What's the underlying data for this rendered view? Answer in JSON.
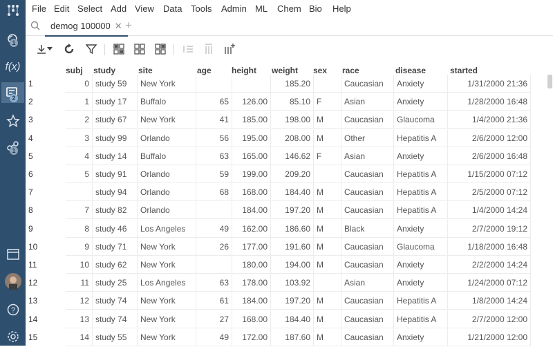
{
  "menu": [
    "File",
    "Edit",
    "Select",
    "Add",
    "View",
    "Data",
    "Tools",
    "Admin",
    "ML",
    "Chem",
    "Bio",
    "Help"
  ],
  "tab": {
    "label": "demog 100000"
  },
  "sidebar_badges": {
    "browse": "1",
    "tables": "2",
    "network": "1"
  },
  "columns": [
    "subj",
    "study",
    "site",
    "age",
    "height",
    "weight",
    "sex",
    "race",
    "disease",
    "started"
  ],
  "rows": [
    {
      "n": "1",
      "subj": "0",
      "study": "study 59",
      "site": "New York",
      "age": "",
      "height": "",
      "weight": "185.20",
      "sex": "",
      "race": "Caucasian",
      "disease": "Anxiety",
      "started": "1/31/2000 21:36"
    },
    {
      "n": "2",
      "subj": "1",
      "study": "study 17",
      "site": "Buffalo",
      "age": "65",
      "height": "126.00",
      "weight": "85.10",
      "sex": "F",
      "race": "Asian",
      "disease": "Anxiety",
      "started": "1/28/2000 16:48"
    },
    {
      "n": "3",
      "subj": "2",
      "study": "study 67",
      "site": "New York",
      "age": "41",
      "height": "185.00",
      "weight": "198.00",
      "sex": "M",
      "race": "Caucasian",
      "disease": "Glaucoma",
      "started": "1/4/2000 21:36"
    },
    {
      "n": "4",
      "subj": "3",
      "study": "study 99",
      "site": "Orlando",
      "age": "56",
      "height": "195.00",
      "weight": "208.00",
      "sex": "M",
      "race": "Other",
      "disease": "Hepatitis A",
      "started": "2/6/2000 12:00"
    },
    {
      "n": "5",
      "subj": "4",
      "study": "study 14",
      "site": "Buffalo",
      "age": "63",
      "height": "165.00",
      "weight": "146.62",
      "sex": "F",
      "race": "Asian",
      "disease": "Anxiety",
      "started": "2/6/2000 16:48"
    },
    {
      "n": "6",
      "subj": "5",
      "study": "study 91",
      "site": "Orlando",
      "age": "59",
      "height": "199.00",
      "weight": "209.20",
      "sex": "",
      "race": "Caucasian",
      "disease": "Hepatitis A",
      "started": "1/15/2000 07:12"
    },
    {
      "n": "7",
      "subj": "",
      "study": "study 94",
      "site": "Orlando",
      "age": "68",
      "height": "168.00",
      "weight": "184.40",
      "sex": "M",
      "race": "Caucasian",
      "disease": "Hepatitis A",
      "started": "2/5/2000 07:12"
    },
    {
      "n": "8",
      "subj": "7",
      "study": "study 82",
      "site": "Orlando",
      "age": "",
      "height": "184.00",
      "weight": "197.20",
      "sex": "M",
      "race": "Caucasian",
      "disease": "Hepatitis A",
      "started": "1/4/2000 14:24"
    },
    {
      "n": "9",
      "subj": "8",
      "study": "study 46",
      "site": "Los Angeles",
      "age": "49",
      "height": "162.00",
      "weight": "186.60",
      "sex": "M",
      "race": "Black",
      "disease": "Anxiety",
      "started": "2/7/2000 19:12"
    },
    {
      "n": "10",
      "subj": "9",
      "study": "study 71",
      "site": "New York",
      "age": "26",
      "height": "177.00",
      "weight": "191.60",
      "sex": "M",
      "race": "Caucasian",
      "disease": "Glaucoma",
      "started": "1/18/2000 16:48"
    },
    {
      "n": "11",
      "subj": "10",
      "study": "study 62",
      "site": "New York",
      "age": "",
      "height": "180.00",
      "weight": "194.00",
      "sex": "M",
      "race": "Caucasian",
      "disease": "Anxiety",
      "started": "2/2/2000 14:24"
    },
    {
      "n": "12",
      "subj": "11",
      "study": "study 25",
      "site": "Los Angeles",
      "age": "63",
      "height": "178.00",
      "weight": "103.92",
      "sex": "",
      "race": "Asian",
      "disease": "Anxiety",
      "started": "1/24/2000 07:12"
    },
    {
      "n": "13",
      "subj": "12",
      "study": "study 74",
      "site": "New York",
      "age": "61",
      "height": "184.00",
      "weight": "197.20",
      "sex": "M",
      "race": "Caucasian",
      "disease": "Hepatitis A",
      "started": "1/8/2000 14:24"
    },
    {
      "n": "14",
      "subj": "13",
      "study": "study 74",
      "site": "New York",
      "age": "27",
      "height": "168.00",
      "weight": "184.40",
      "sex": "M",
      "race": "Caucasian",
      "disease": "Hepatitis A",
      "started": "2/7/2000 12:00"
    },
    {
      "n": "15",
      "subj": "14",
      "study": "study 55",
      "site": "New York",
      "age": "49",
      "height": "172.00",
      "weight": "187.60",
      "sex": "M",
      "race": "Caucasian",
      "disease": "Anxiety",
      "started": "1/21/2000 12:00"
    }
  ]
}
